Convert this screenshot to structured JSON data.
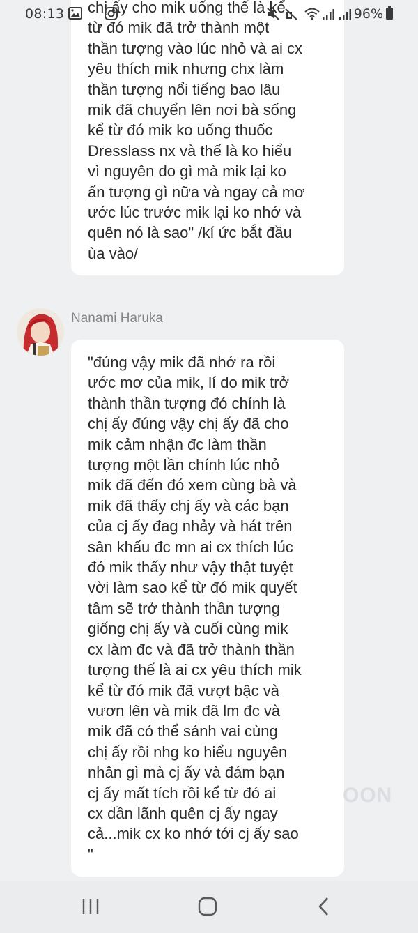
{
  "status_bar": {
    "time": "08:13",
    "battery": "96%",
    "icons": [
      "gallery-icon",
      "instagram-icon",
      "mute-icon",
      "wifi-icon",
      "signal-icon",
      "signal-icon",
      "battery-icon"
    ]
  },
  "messages": [
    {
      "text": "chị ấy cho mik uống thế là kể\ntừ đó mik đã trở thành một\nthần tượng vào lúc nhỏ và ai cx\nyêu thích mik nhưng chx làm\nthần tượng nổi tiếng bao lâu\nmik đã chuyển lên nơi bà sống\nkể từ đó mik ko uống thuốc\nDresslass nx và thế là ko hiểu\nvì nguyên do gì mà mik lại ko\nấn tượng gì nữa và ngay cả mơ\nước lúc trước mik lại ko nhớ và\nquên nó là sao\" /kí ức bắt đầu\nùa vào/"
    },
    {
      "sender": "Nanami Haruka",
      "text": "\"đúng vậy mik đã nhớ ra rồi\nước mơ của mik, lí do mik trở\nthành thần tượng đó chính là\nchị ấy đúng vậy chị ấy đã cho\nmik cảm nhận đc làm thần\ntượng một lần chính lúc nhỏ\nmik đã đến đó xem cùng bà và\nmik đã thấy chj ấy và các bạn\ncủa cj ấy đag nhảy và hát trên\nsân khấu đc mn ai cx thích lúc\nđó mik thấy như vậy thật tuyệt\nvời làm sao kể từ đó mik quyết\ntâm sẽ trở thành thần tượng\ngiống chị ấy và cuối cùng mik\ncx làm đc và đã trở thành thần\ntượng thế là ai cx yêu thích mik\nkể từ đó mik đã vượt bậc và\nvươn lên và mik đã lm đc và\nmik đã có thể sánh vai cùng\nchị ấy rồi nhg ko hiểu nguyên\nnhân gì mà cj ấy và đám bạn\ncj ấy mất tích rồi kể từ đó ai\ncx dần lãnh quên cj ấy ngay\ncả...mik cx ko nhớ tới cj ấy sao\n\""
    }
  ],
  "watermark": "OON",
  "nav_bar": {
    "buttons": [
      "recent-apps-icon",
      "home-icon",
      "back-icon"
    ]
  }
}
